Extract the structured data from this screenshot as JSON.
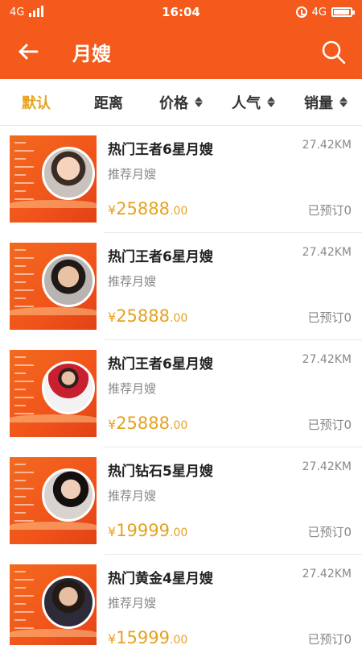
{
  "status_bar": {
    "network_left": "4G",
    "time": "16:04",
    "network_right": "4G",
    "battery_level": 0.95
  },
  "header": {
    "title": "月嫂",
    "back_icon": "arrow-left-icon",
    "search_icon": "search-icon"
  },
  "sort_tabs": [
    {
      "label": "默认",
      "active": true
    },
    {
      "label": "距离",
      "active": false
    },
    {
      "label": "价格",
      "active": false
    },
    {
      "label": "人气",
      "active": false
    },
    {
      "label": "销量",
      "active": false
    }
  ],
  "listings": [
    {
      "title": "热门王者6星月嫂",
      "subtitle": "推荐月嫂",
      "distance": "27.42KM",
      "currency": "¥",
      "price_int": "25888",
      "price_dec": ".00",
      "booked": "已预订0"
    },
    {
      "title": "热门王者6星月嫂",
      "subtitle": "推荐月嫂",
      "distance": "27.42KM",
      "currency": "¥",
      "price_int": "25888",
      "price_dec": ".00",
      "booked": "已预订0"
    },
    {
      "title": "热门王者6星月嫂",
      "subtitle": "推荐月嫂",
      "distance": "27.42KM",
      "currency": "¥",
      "price_int": "25888",
      "price_dec": ".00",
      "booked": "已预订0"
    },
    {
      "title": "热门钻石5星月嫂",
      "subtitle": "推荐月嫂",
      "distance": "27.42KM",
      "currency": "¥",
      "price_int": "19999",
      "price_dec": ".00",
      "booked": "已预订0"
    },
    {
      "title": "热门黄金4星月嫂",
      "subtitle": "推荐月嫂",
      "distance": "27.42KM",
      "currency": "¥",
      "price_int": "15999",
      "price_dec": ".00",
      "booked": "已预订0"
    }
  ],
  "colors": {
    "brand": "#f45a1b",
    "accent": "#e6a21f"
  }
}
